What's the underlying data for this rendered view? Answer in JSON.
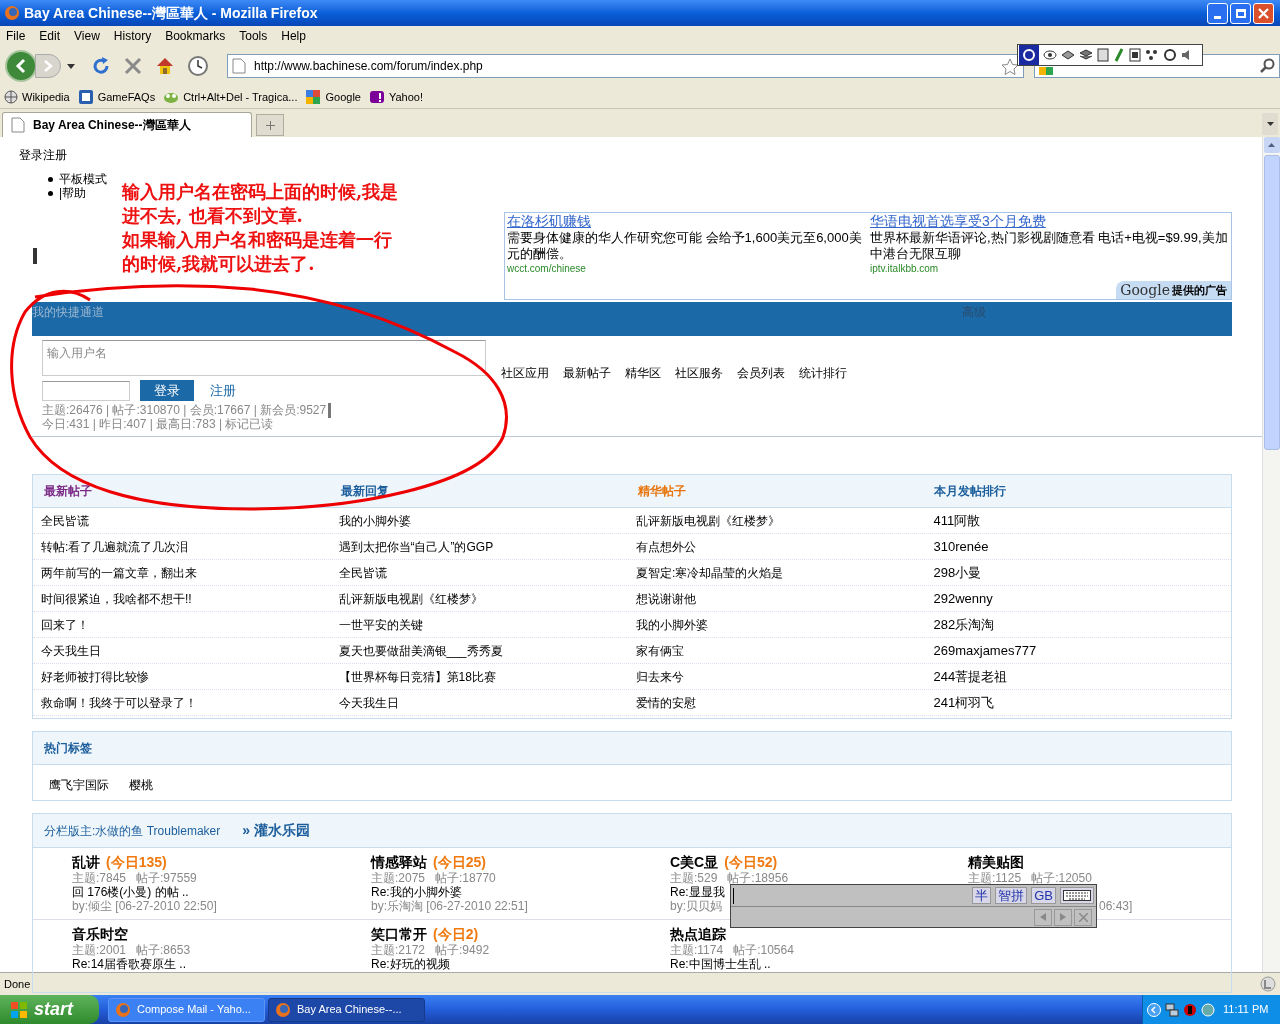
{
  "window": {
    "title": "Bay Area Chinese--灣區華人 - Mozilla Firefox"
  },
  "menu": [
    "File",
    "Edit",
    "View",
    "History",
    "Bookmarks",
    "Tools",
    "Help"
  ],
  "address": "http://www.bachinese.com/forum/index.php",
  "bookmarks": [
    {
      "label": "Wikipedia",
      "kind": "wiki"
    },
    {
      "label": "GameFAQs",
      "kind": "faq"
    },
    {
      "label": "Ctrl+Alt+Del - Tragica...",
      "kind": "cad"
    },
    {
      "label": "Google",
      "kind": "google"
    },
    {
      "label": "Yahoo!",
      "kind": "yahoo"
    }
  ],
  "tabs": [
    {
      "label": "Bay Area Chinese--灣區華人",
      "selected": true
    }
  ],
  "page": {
    "top_link": "登录注册",
    "menu_items": [
      "平板模式",
      "|帮助"
    ],
    "annotation": [
      "输入用户名在密码上面的时候,我是",
      "进不去, 也看不到文章.",
      "如果输入用户名和密码是连着一行",
      "的时候,我就可以进去了."
    ],
    "ads": [
      {
        "title": "在洛杉矶赚钱",
        "body": "需要身体健康的华人作研究您可能 会给予1,600美元至6,000美元的酬偿。",
        "url": "wcct.com/chinese"
      },
      {
        "title": "华语电视首选享受3个月免费",
        "body": "世界杯最新华语评论,热门影视剧随意看 电话+电视=$9.99,美加中港台无限互聊",
        "url": "iptv.italkbb.com"
      }
    ],
    "ad_badge": {
      "brand": "Google",
      "text": "提供的广告"
    },
    "quickbar": {
      "left": "我的快捷通道",
      "right": "高级"
    },
    "login": {
      "username_placeholder": "输入用户名",
      "button": "登录",
      "register": "注册"
    },
    "stats": [
      "主题:26476 | 帖子:310870 | 会员:17667 | 新会员:9527",
      "今日:431 | 昨日:407 | 最高日:783 | 标记已读"
    ],
    "nav": [
      "社区应用",
      "最新帖子",
      "精华区",
      "社区服务",
      "会员列表",
      "统计排行"
    ],
    "table": {
      "columns": [
        {
          "label": "最新帖子",
          "color": "#7b2a86"
        },
        {
          "label": "最新回复",
          "color": "#1c5e9c"
        },
        {
          "label": "精华帖子",
          "color": "#e8750c"
        },
        {
          "label": "本月发帖排行",
          "color": "#1c5e9c"
        }
      ],
      "rows": [
        [
          "全民皆谎",
          "我的小脚外婆",
          "乱评新版电视剧《红楼梦》",
          "411阿散"
        ],
        [
          "转帖:看了几遍就流了几次泪",
          "遇到太把你当“自己人”的GGP",
          "有点想外公",
          "310renée"
        ],
        [
          "两年前写的一篇文章，翻出来",
          "全民皆谎",
          "夏智定:寒冷却晶莹的火焰是",
          "298小曼"
        ],
        [
          "时间很紧迫，我啥都不想干!!",
          "乱评新版电视剧《红楼梦》",
          "想说谢谢他",
          "292wenny"
        ],
        [
          "回来了！",
          "一世平安的关键",
          "我的小脚外婆",
          "282乐淘淘"
        ],
        [
          "今天我生日",
          "夏天也要做甜美滴银___秀秀夏",
          "家有俩宝",
          "269maxjames777"
        ],
        [
          "好老师被打得比较惨",
          "【世界杯每日竞猜】第18比赛",
          "归去来兮",
          "244菩提老祖"
        ],
        [
          "救命啊！我终于可以登录了！",
          "今天我生日",
          "爱情的安慰",
          "241柯羽飞"
        ]
      ]
    },
    "tags": {
      "title": "热门标签",
      "items": [
        "鹰飞宇国际",
        "樱桃"
      ]
    },
    "forum": {
      "moderators": "分栏版主:水做的鱼 Troublemaker",
      "title": "» 灌水乐园",
      "rows": [
        [
          {
            "name": "乱讲",
            "today": "(今日135)",
            "stats": "主题:7845   帖子:97559",
            "last": "回 176楼(小曼) 的帖 ..",
            "by": "by:倾尘 [06-27-2010 22:50]"
          },
          {
            "name": "情感驿站",
            "today": "(今日25)",
            "stats": "主题:2075   帖子:18770",
            "last": "Re:我的小脚外婆",
            "by": "by:乐淘淘 [06-27-2010 22:51]"
          },
          {
            "name": "C美C显",
            "today": "(今日52)",
            "stats": "主题:529   帖子:18956",
            "last": "Re:显显我",
            "by": "by:贝贝妈"
          },
          {
            "name": "精美贴图",
            "stats": "主题:1125   帖子:12050",
            "by": "06:43]"
          }
        ],
        [
          {
            "name": "音乐时空",
            "stats": "主题:2001   帖子:8653",
            "last": "Re:14届香歌赛原生 .."
          },
          {
            "name": "笑口常开",
            "today": "(今日2)",
            "stats": "主题:2172   帖子:9492",
            "last": "Re:好玩的视频"
          },
          {
            "name": "热点追踪",
            "stats": "主题:1174   帖子:10564",
            "last": "Re:中国博士生乱 .."
          }
        ]
      ]
    }
  },
  "ime": {
    "buttons": [
      "半",
      "智拼",
      "GB"
    ]
  },
  "status": "Done",
  "taskbar": {
    "start": "start",
    "tasks": [
      {
        "label": "Compose Mail - Yaho...",
        "selected": false
      },
      {
        "label": "Bay Area Chinese--...",
        "selected": true
      }
    ],
    "clock": "11:11 PM"
  }
}
